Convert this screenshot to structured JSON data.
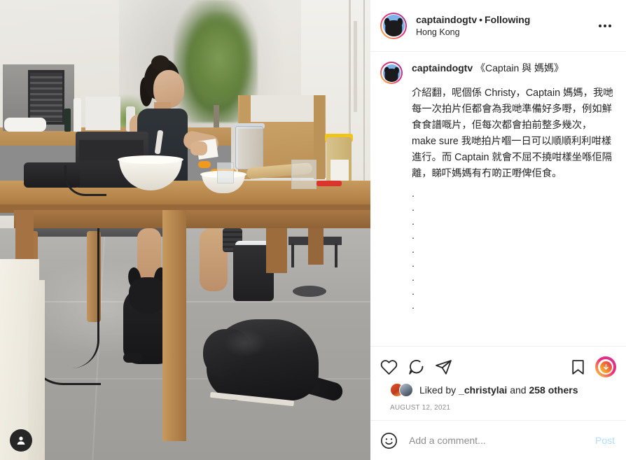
{
  "header": {
    "username": "captaindogtv",
    "separator": "•",
    "following_label": "Following",
    "location": "Hong Kong",
    "more_icon": "more-options-icon"
  },
  "caption": {
    "username": "captaindogtv",
    "title": "《Captain 與 媽媽》",
    "text": "介紹翻，呢個係 Christy，Captain 媽媽，我哋每一次拍片佢都會為我哋準備好多嘢，例如鮮食食譜嘅片，佢每次都會拍前整多幾次，make sure 我哋拍片嗰一日可以順順利利咁樣進行。而 Captain 就會不屈不撓咁樣坐喺佢隔離，睇吓媽媽有冇啲正嘢俾佢食。",
    "dots": [
      ".",
      ".",
      ".",
      ".",
      ".",
      ".",
      ".",
      ".",
      "."
    ]
  },
  "actions": {
    "like_icon": "heart-icon",
    "comment_icon": "comment-bubble-icon",
    "share_icon": "share-paper-plane-icon",
    "bookmark_icon": "bookmark-icon",
    "download_icon": "download-gradient-icon"
  },
  "likes": {
    "prefix": "Liked by ",
    "user": "_christylai",
    "middle": " and ",
    "count": "258",
    "suffix": " others",
    "full_text": "Liked by _christylai and 258 others"
  },
  "date": "AUGUST 12, 2021",
  "comment_bar": {
    "emoji_icon": "emoji-smiley-icon",
    "placeholder": "Add a comment...",
    "value": "",
    "post_label": "Post"
  },
  "media": {
    "profile_tag_icon": "person-tag-icon",
    "alt": "Woman preparing food at a wooden table with a black dog lying underneath"
  },
  "colors": {
    "accent_blue": "#0095f6",
    "post_disabled": "#b3dcfc",
    "text_primary": "#262626",
    "text_secondary": "#8e8e8e",
    "divider": "#efefef"
  }
}
